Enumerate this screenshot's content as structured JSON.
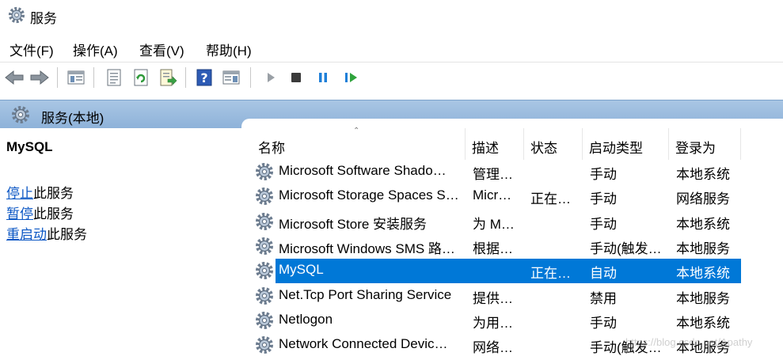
{
  "window": {
    "title": "服务"
  },
  "menu": [
    "文件(F)",
    "操作(A)",
    "查看(V)",
    "帮助(H)"
  ],
  "toolbar": {
    "buttons": [
      "back-arrow-icon",
      "forward-arrow-icon",
      "console-tree-icon",
      "properties-icon",
      "refresh-icon",
      "export-icon",
      "help-icon",
      "action-pane-icon",
      "play-icon",
      "stop-icon",
      "pause-icon",
      "restart-icon"
    ]
  },
  "band": {
    "title": "服务(本地)"
  },
  "left": {
    "service_name": "MySQL",
    "actions": [
      {
        "link": "停止",
        "rest": "此服务"
      },
      {
        "link": "暂停",
        "rest": "此服务"
      },
      {
        "link": "重启动",
        "rest": "此服务"
      }
    ]
  },
  "table": {
    "columns": [
      "名称",
      "描述",
      "状态",
      "启动类型",
      "登录为"
    ],
    "rows": [
      {
        "name": "Microsoft Software Shado…",
        "desc": "管理…",
        "status": "",
        "startup": "手动",
        "logon": "本地系统",
        "selected": false
      },
      {
        "name": "Microsoft Storage Spaces S…",
        "desc": "Micr…",
        "status": "正在…",
        "startup": "手动",
        "logon": "网络服务",
        "selected": false
      },
      {
        "name": "Microsoft Store 安装服务",
        "desc": "为 M…",
        "status": "",
        "startup": "手动",
        "logon": "本地系统",
        "selected": false
      },
      {
        "name": "Microsoft Windows SMS 路…",
        "desc": "根据…",
        "status": "",
        "startup": "手动(触发…",
        "logon": "本地服务",
        "selected": false
      },
      {
        "name": "MySQL",
        "desc": "",
        "status": "正在…",
        "startup": "自动",
        "logon": "本地系统",
        "selected": true
      },
      {
        "name": "Net.Tcp Port Sharing Service",
        "desc": "提供…",
        "status": "",
        "startup": "禁用",
        "logon": "本地服务",
        "selected": false
      },
      {
        "name": "Netlogon",
        "desc": "为用…",
        "status": "",
        "startup": "手动",
        "logon": "本地系统",
        "selected": false
      },
      {
        "name": "Network Connected Devic…",
        "desc": "网络…",
        "status": "",
        "startup": "手动(触发…",
        "logon": "本地服务",
        "selected": false
      }
    ]
  },
  "watermark": "https://blog.csdn.net/Apathy",
  "colors": {
    "selection": "#0078d7",
    "link": "#0a56c4",
    "band": "#9dbde0"
  }
}
